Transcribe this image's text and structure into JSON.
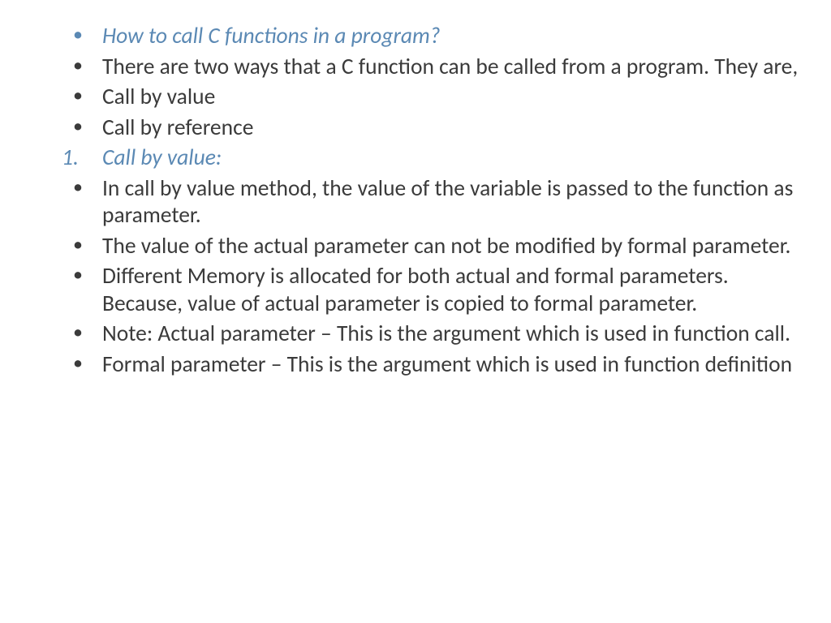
{
  "slide": {
    "items": [
      {
        "text": "How to call C functions in a program?",
        "style": "question"
      },
      {
        "text": "There are two ways that a C function can be called from a program. They are,",
        "style": "plain"
      },
      {
        "text": "Call by value",
        "style": "plain"
      },
      {
        "text": "Call by reference",
        "style": "plain"
      },
      {
        "text": "Call by value:",
        "style": "subhead-numbered"
      },
      {
        "text": "In call by value method, the value of the variable is passed to the function as parameter.",
        "style": "plain"
      },
      {
        "text": "The value of the actual parameter can not be modified by formal parameter.",
        "style": "plain"
      },
      {
        "text": "Different Memory is allocated for both actual and formal parameters. Because, value of actual parameter is copied to formal parameter.",
        "style": "plain"
      },
      {
        "text": "Note: Actual parameter – This is the argument which is used in function call.",
        "style": "plain"
      },
      {
        "text": "Formal parameter – This is the argument which is used in function definition",
        "style": "plain"
      }
    ]
  }
}
